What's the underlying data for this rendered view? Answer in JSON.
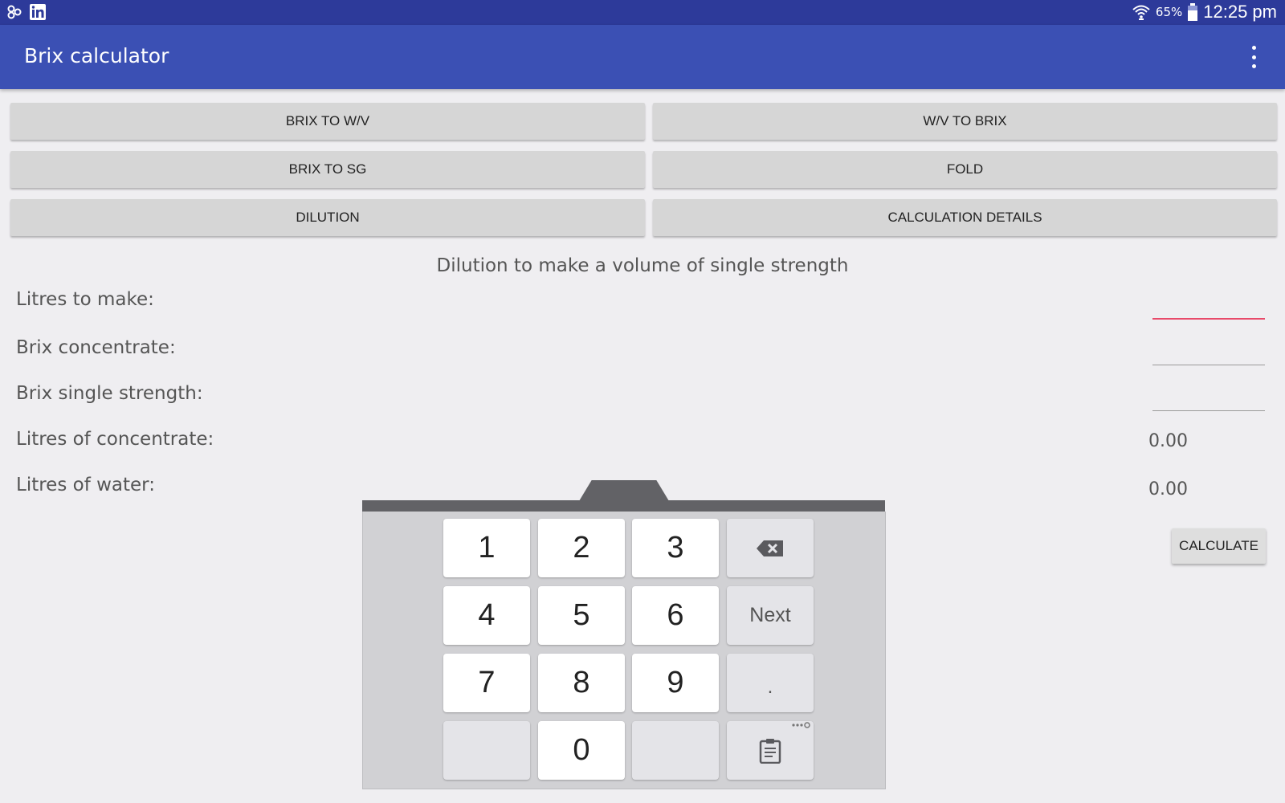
{
  "status_bar": {
    "battery_percent": "65%",
    "time": "12:25 pm",
    "left_icons": [
      "notification-app-icon",
      "linkedin-icon"
    ],
    "right_icons": [
      "wifi-icon",
      "battery-icon"
    ]
  },
  "app_bar": {
    "title": "Brix calculator"
  },
  "modes": {
    "brix_to_wv": "BRIX TO W/V",
    "wv_to_brix": "W/V TO BRIX",
    "brix_to_sg": "BRIX TO SG",
    "fold": "FOLD",
    "dilution": "DILUTION",
    "calculation_details": "CALCULATION DETAILS"
  },
  "dilution": {
    "title": "Dilution to make a volume of single strength",
    "litres_to_make_label": "Litres to make:",
    "litres_to_make_value": "",
    "brix_concentrate_label": "Brix concentrate:",
    "brix_concentrate_value": "",
    "brix_single_strength_label": "Brix single strength:",
    "brix_single_strength_value": "",
    "litres_of_concentrate_label": "Litres of concentrate:",
    "litres_of_concentrate_value": "0.00",
    "litres_of_water_label": "Litres of water:",
    "litres_of_water_value": "0.00",
    "calculate_label": "CALCULATE"
  },
  "keyboard": {
    "k1": "1",
    "k2": "2",
    "k3": "3",
    "k4": "4",
    "k5": "5",
    "k6": "6",
    "k7": "7",
    "k8": "8",
    "k9": "9",
    "k0": "0",
    "next": "Next",
    "dot": "."
  },
  "colors": {
    "status_bar": "#2d3a9a",
    "app_bar": "#3b50b4",
    "active_underline": "#e84a6a",
    "background": "#efeef1"
  }
}
